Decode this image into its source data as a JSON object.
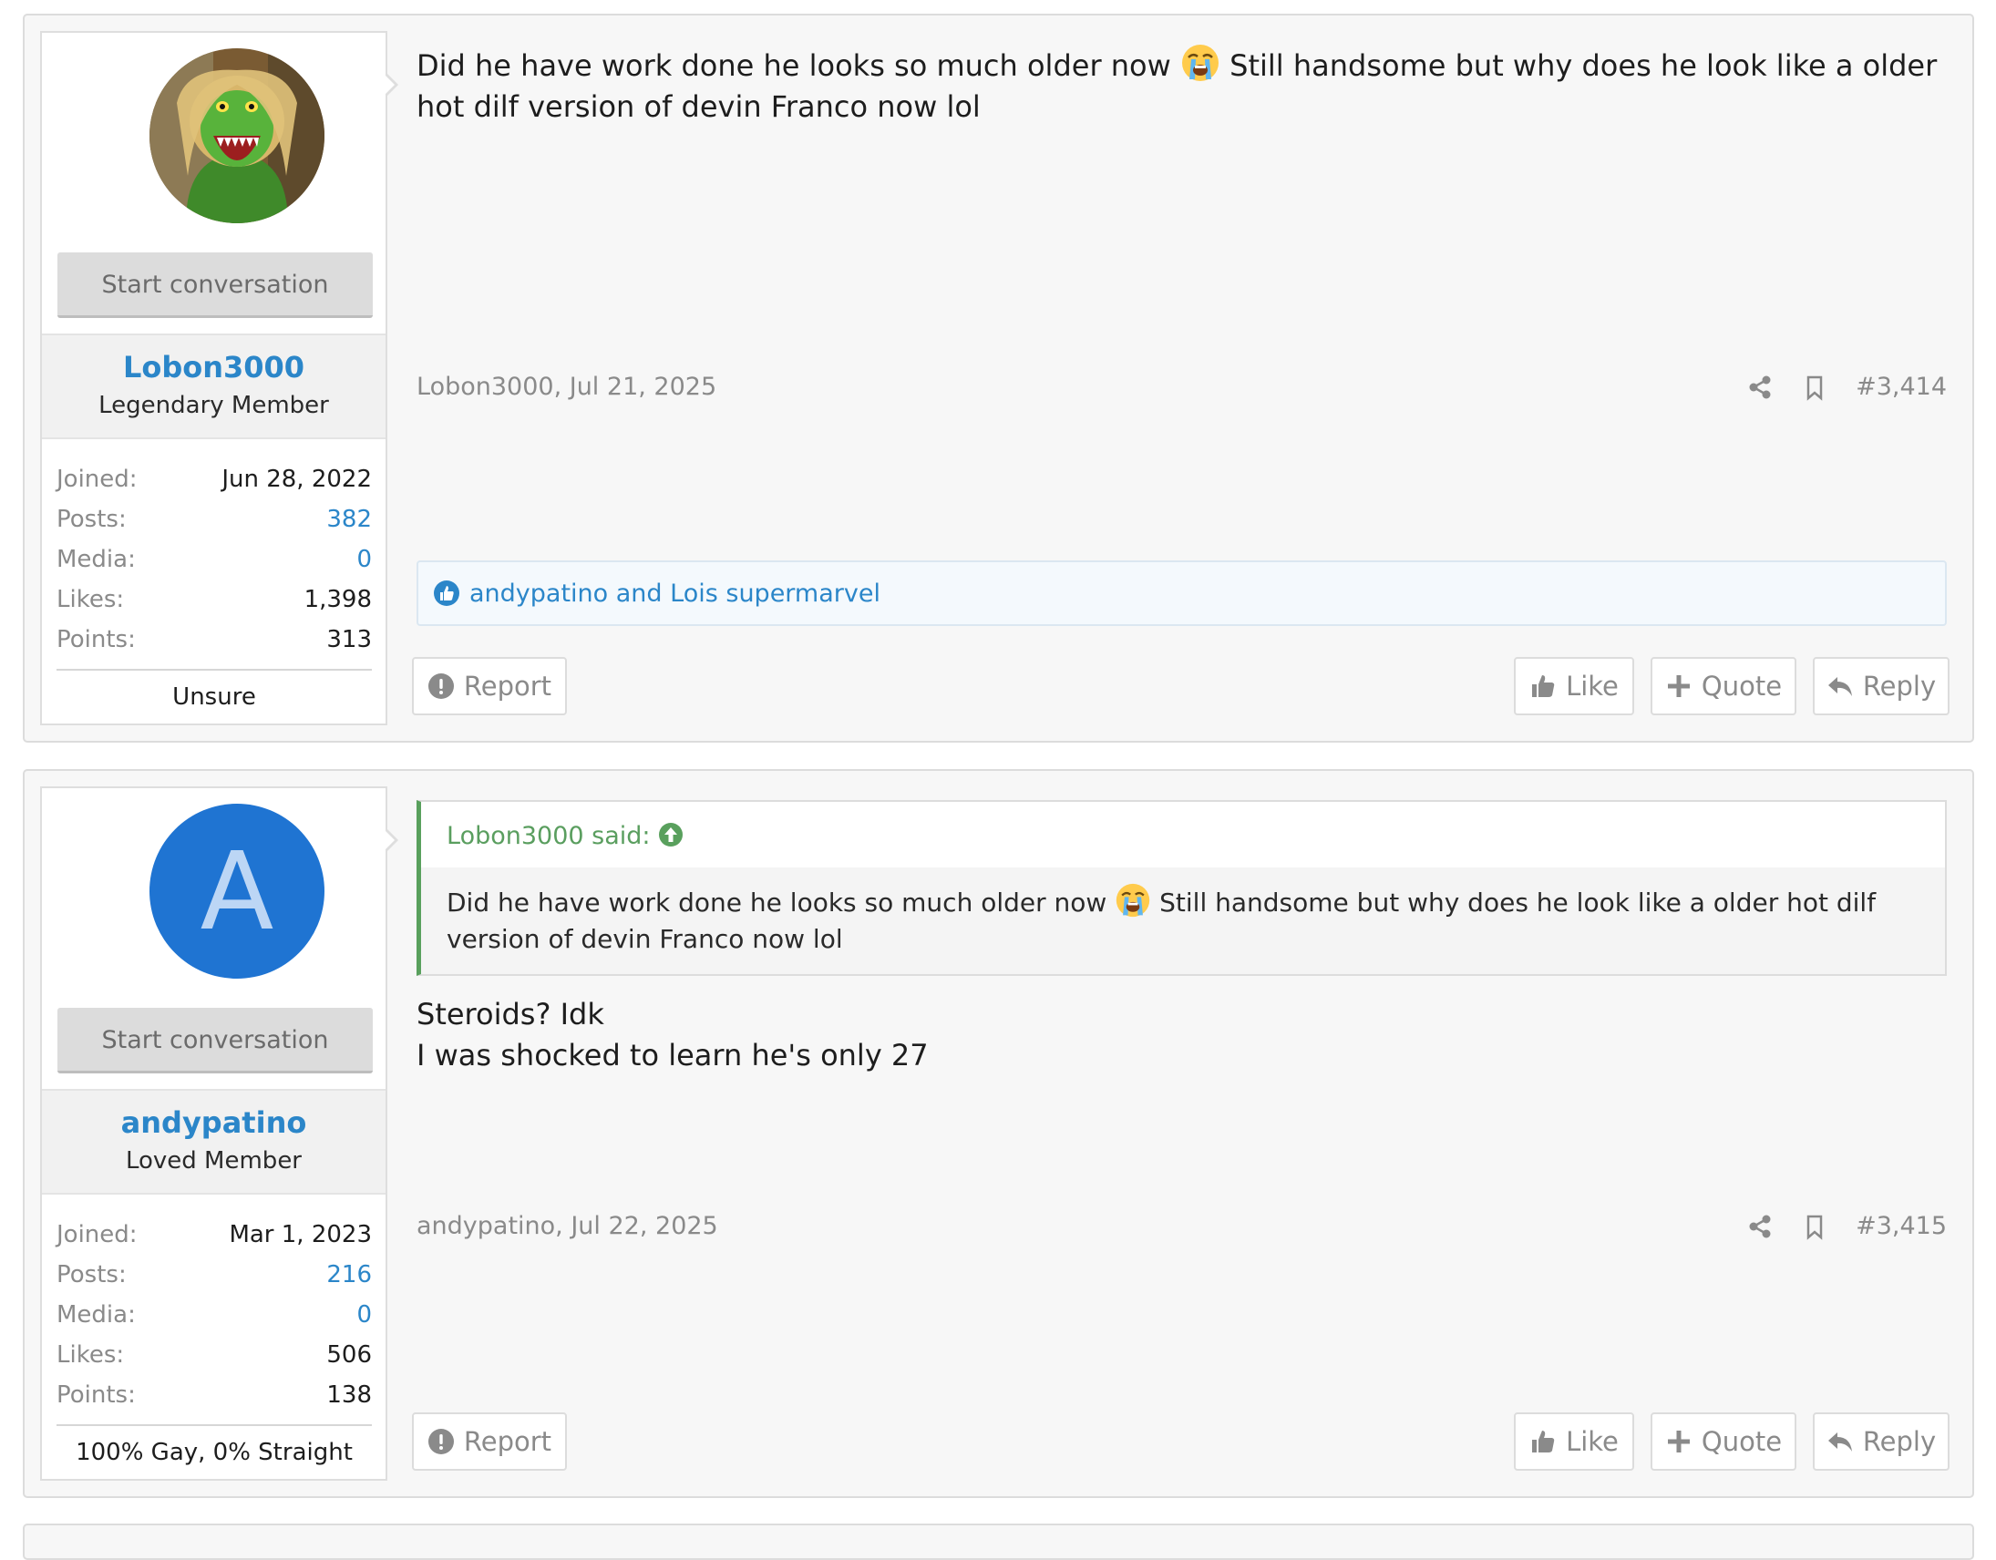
{
  "posts": [
    {
      "user": {
        "name": "Lobon3000",
        "title": "Legendary Member",
        "start_label": "Start conversation",
        "stats": [
          {
            "label": "Joined:",
            "value": "Jun 28, 2022",
            "link": false
          },
          {
            "label": "Posts:",
            "value": "382",
            "link": true
          },
          {
            "label": "Media:",
            "value": "0",
            "link": true
          },
          {
            "label": "Likes:",
            "value": "1,398",
            "link": false
          },
          {
            "label": "Points:",
            "value": "313",
            "link": false
          }
        ],
        "custom": "Unsure"
      },
      "message_part1": "Did he have work done he looks so much older now ",
      "message_part2": " Still handsome but why does he look like a older hot dilf version of devin Franco now lol",
      "emoji_icon": "loudly-crying-face-icon",
      "meta": {
        "author_date": "Lobon3000, Jul 21, 2025",
        "number": "#3,414"
      },
      "reactions": "andypatino and Lois supermarvel",
      "actions": {
        "report": "Report",
        "like": "Like",
        "quote": "Quote",
        "reply": "Reply"
      }
    },
    {
      "user": {
        "name": "andypatino",
        "title": "Loved Member",
        "avatar_letter": "A",
        "start_label": "Start conversation",
        "stats": [
          {
            "label": "Joined:",
            "value": "Mar 1, 2023",
            "link": false
          },
          {
            "label": "Posts:",
            "value": "216",
            "link": true
          },
          {
            "label": "Media:",
            "value": "0",
            "link": true
          },
          {
            "label": "Likes:",
            "value": "506",
            "link": false
          },
          {
            "label": "Points:",
            "value": "138",
            "link": false
          }
        ],
        "custom": "100% Gay, 0% Straight"
      },
      "quote": {
        "author": "Lobon3000 said:",
        "text_part1": "Did he have work done he looks so much older now ",
        "text_part2": " Still handsome but why does he look like a older hot dilf version of devin Franco now lol"
      },
      "message_line1": "Steroids? Idk",
      "message_line2": "I was shocked to learn he's only 27",
      "meta": {
        "author_date": "andypatino, Jul 22, 2025",
        "number": "#3,415"
      },
      "actions": {
        "report": "Report",
        "like": "Like",
        "quote": "Quote",
        "reply": "Reply"
      }
    }
  ],
  "colors": {
    "accent": "#2b86c9",
    "quote_green": "#59a05d",
    "avatar_blue": "#1f74d2"
  }
}
